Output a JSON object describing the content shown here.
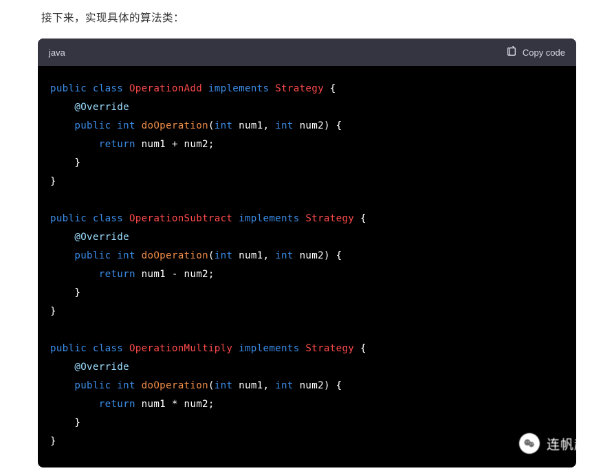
{
  "article": {
    "intro": "接下来，实现具体的算法类："
  },
  "codeblock": {
    "language": "java",
    "copy_label": "Copy code",
    "tokens": [
      [
        [
          "kw",
          "public"
        ],
        [
          "pl",
          " "
        ],
        [
          "kw",
          "class"
        ],
        [
          "pl",
          " "
        ],
        [
          "cls",
          "OperationAdd"
        ],
        [
          "pl",
          " "
        ],
        [
          "kw",
          "implements"
        ],
        [
          "pl",
          " "
        ],
        [
          "cls",
          "Strategy"
        ],
        [
          "pl",
          " {"
        ]
      ],
      [
        [
          "pl",
          "    "
        ],
        [
          "anno",
          "@Override"
        ]
      ],
      [
        [
          "pl",
          "    "
        ],
        [
          "kw",
          "public"
        ],
        [
          "pl",
          " "
        ],
        [
          "kw",
          "int"
        ],
        [
          "pl",
          " "
        ],
        [
          "fn",
          "doOperation"
        ],
        [
          "pl",
          "("
        ],
        [
          "kw",
          "int"
        ],
        [
          "pl",
          " num1, "
        ],
        [
          "kw",
          "int"
        ],
        [
          "pl",
          " num2) {"
        ]
      ],
      [
        [
          "pl",
          "        "
        ],
        [
          "kw",
          "return"
        ],
        [
          "pl",
          " num1 + num2;"
        ]
      ],
      [
        [
          "pl",
          "    }"
        ]
      ],
      [
        [
          "pl",
          "}"
        ]
      ],
      [
        [
          "pl",
          ""
        ]
      ],
      [
        [
          "kw",
          "public"
        ],
        [
          "pl",
          " "
        ],
        [
          "kw",
          "class"
        ],
        [
          "pl",
          " "
        ],
        [
          "cls",
          "OperationSubtract"
        ],
        [
          "pl",
          " "
        ],
        [
          "kw",
          "implements"
        ],
        [
          "pl",
          " "
        ],
        [
          "cls",
          "Strategy"
        ],
        [
          "pl",
          " {"
        ]
      ],
      [
        [
          "pl",
          "    "
        ],
        [
          "anno",
          "@Override"
        ]
      ],
      [
        [
          "pl",
          "    "
        ],
        [
          "kw",
          "public"
        ],
        [
          "pl",
          " "
        ],
        [
          "kw",
          "int"
        ],
        [
          "pl",
          " "
        ],
        [
          "fn",
          "doOperation"
        ],
        [
          "pl",
          "("
        ],
        [
          "kw",
          "int"
        ],
        [
          "pl",
          " num1, "
        ],
        [
          "kw",
          "int"
        ],
        [
          "pl",
          " num2) {"
        ]
      ],
      [
        [
          "pl",
          "        "
        ],
        [
          "kw",
          "return"
        ],
        [
          "pl",
          " num1 - num2;"
        ]
      ],
      [
        [
          "pl",
          "    }"
        ]
      ],
      [
        [
          "pl",
          "}"
        ]
      ],
      [
        [
          "pl",
          ""
        ]
      ],
      [
        [
          "kw",
          "public"
        ],
        [
          "pl",
          " "
        ],
        [
          "kw",
          "class"
        ],
        [
          "pl",
          " "
        ],
        [
          "cls",
          "OperationMultiply"
        ],
        [
          "pl",
          " "
        ],
        [
          "kw",
          "implements"
        ],
        [
          "pl",
          " "
        ],
        [
          "cls",
          "Strategy"
        ],
        [
          "pl",
          " {"
        ]
      ],
      [
        [
          "pl",
          "    "
        ],
        [
          "anno",
          "@Override"
        ]
      ],
      [
        [
          "pl",
          "    "
        ],
        [
          "kw",
          "public"
        ],
        [
          "pl",
          " "
        ],
        [
          "kw",
          "int"
        ],
        [
          "pl",
          " "
        ],
        [
          "fn",
          "doOperation"
        ],
        [
          "pl",
          "("
        ],
        [
          "kw",
          "int"
        ],
        [
          "pl",
          " num1, "
        ],
        [
          "kw",
          "int"
        ],
        [
          "pl",
          " num2) {"
        ]
      ],
      [
        [
          "pl",
          "        "
        ],
        [
          "kw",
          "return"
        ],
        [
          "pl",
          " num1 * num2;"
        ]
      ],
      [
        [
          "pl",
          "    }"
        ]
      ],
      [
        [
          "pl",
          "}"
        ]
      ]
    ]
  },
  "watermark": {
    "text": "连帆起航"
  }
}
